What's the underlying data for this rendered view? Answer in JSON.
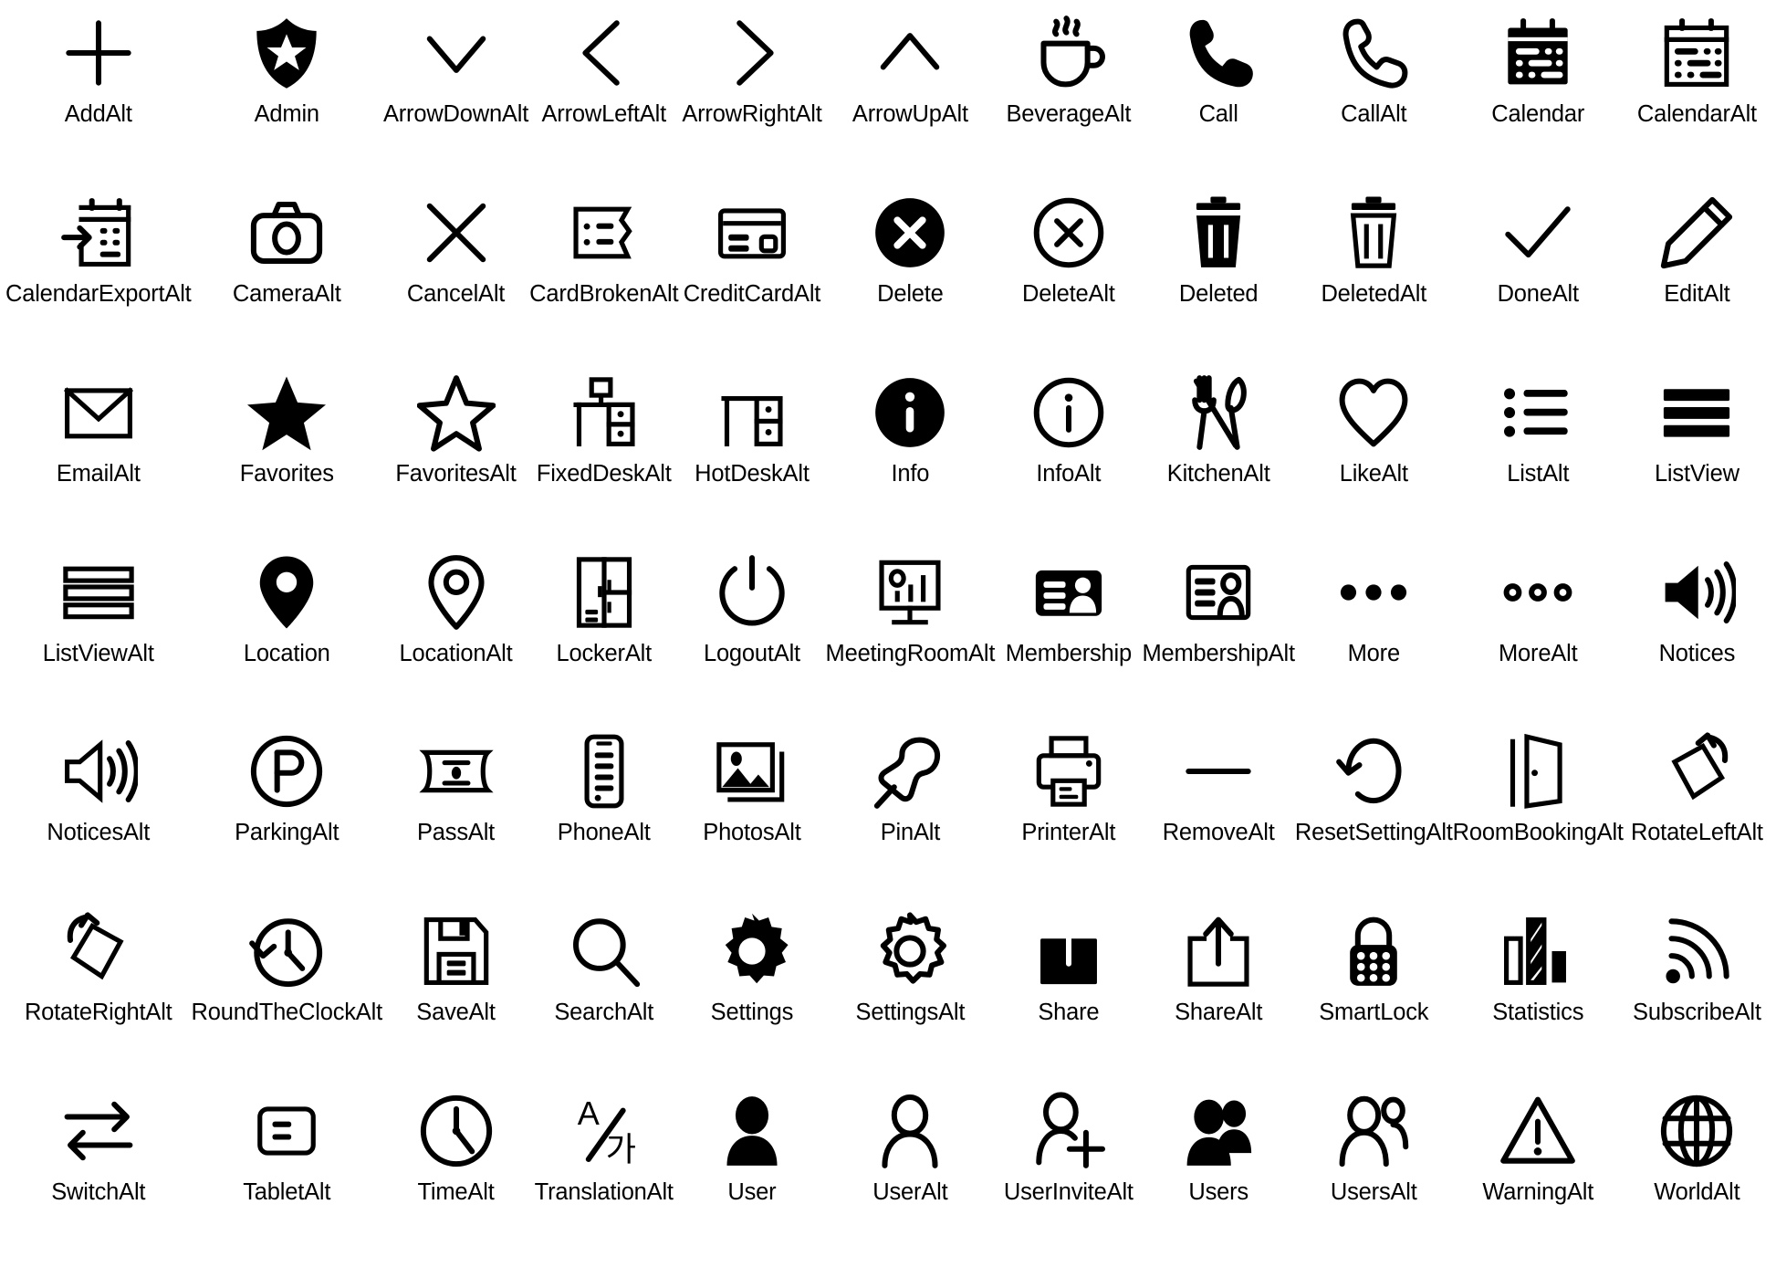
{
  "page": {
    "title": "Icon Set Sheet",
    "background_color": "#ffffff",
    "icon_color": "#000000",
    "columns": 11,
    "rows": 7,
    "total_icons": 77
  },
  "icons": [
    {
      "label": "AddAlt",
      "icon": "plus-icon"
    },
    {
      "label": "Admin",
      "icon": "shield-star-filled-icon"
    },
    {
      "label": "ArrowDownAlt",
      "icon": "chevron-down-icon"
    },
    {
      "label": "ArrowLeftAlt",
      "icon": "chevron-left-icon"
    },
    {
      "label": "ArrowRightAlt",
      "icon": "chevron-right-icon"
    },
    {
      "label": "ArrowUpAlt",
      "icon": "chevron-up-icon"
    },
    {
      "label": "BeverageAlt",
      "icon": "coffee-cup-icon"
    },
    {
      "label": "Call",
      "icon": "phone-handset-filled-icon"
    },
    {
      "label": "CallAlt",
      "icon": "phone-handset-outline-icon"
    },
    {
      "label": "Calendar",
      "icon": "calendar-filled-icon"
    },
    {
      "label": "CalendarAlt",
      "icon": "calendar-outline-icon"
    },
    {
      "label": "CalendarExportAlt",
      "icon": "calendar-export-icon"
    },
    {
      "label": "CameraAlt",
      "icon": "camera-icon"
    },
    {
      "label": "CancelAlt",
      "icon": "close-x-icon"
    },
    {
      "label": "CardBrokenAlt",
      "icon": "card-broken-icon"
    },
    {
      "label": "CreditCardAlt",
      "icon": "credit-card-icon"
    },
    {
      "label": "Delete",
      "icon": "close-circle-filled-icon"
    },
    {
      "label": "DeleteAlt",
      "icon": "close-circle-outline-icon"
    },
    {
      "label": "Deleted",
      "icon": "trash-filled-icon"
    },
    {
      "label": "DeletedAlt",
      "icon": "trash-outline-icon"
    },
    {
      "label": "DoneAlt",
      "icon": "check-icon"
    },
    {
      "label": "EditAlt",
      "icon": "pencil-icon"
    },
    {
      "label": "EmailAlt",
      "icon": "envelope-icon"
    },
    {
      "label": "Favorites",
      "icon": "star-filled-icon"
    },
    {
      "label": "FavoritesAlt",
      "icon": "star-outline-icon"
    },
    {
      "label": "FixedDeskAlt",
      "icon": "fixed-desk-icon"
    },
    {
      "label": "HotDeskAlt",
      "icon": "hot-desk-icon"
    },
    {
      "label": "Info",
      "icon": "info-circle-filled-icon"
    },
    {
      "label": "InfoAlt",
      "icon": "info-circle-outline-icon"
    },
    {
      "label": "KitchenAlt",
      "icon": "fork-spoon-icon"
    },
    {
      "label": "LikeAlt",
      "icon": "heart-outline-icon"
    },
    {
      "label": "ListAlt",
      "icon": "bullet-list-icon"
    },
    {
      "label": "ListView",
      "icon": "list-view-filled-icon"
    },
    {
      "label": "ListViewAlt",
      "icon": "list-view-outline-icon"
    },
    {
      "label": "Location",
      "icon": "map-pin-filled-icon"
    },
    {
      "label": "LocationAlt",
      "icon": "map-pin-outline-icon"
    },
    {
      "label": "LockerAlt",
      "icon": "locker-icon"
    },
    {
      "label": "LogoutAlt",
      "icon": "power-icon"
    },
    {
      "label": "MeetingRoomAlt",
      "icon": "meeting-room-icon"
    },
    {
      "label": "Membership",
      "icon": "membership-card-filled-icon"
    },
    {
      "label": "MembershipAlt",
      "icon": "membership-card-outline-icon"
    },
    {
      "label": "More",
      "icon": "more-dots-filled-icon"
    },
    {
      "label": "MoreAlt",
      "icon": "more-dots-outline-icon"
    },
    {
      "label": "Notices",
      "icon": "megaphone-filled-icon"
    },
    {
      "label": "NoticesAlt",
      "icon": "megaphone-outline-icon"
    },
    {
      "label": "ParkingAlt",
      "icon": "parking-circle-icon"
    },
    {
      "label": "PassAlt",
      "icon": "pass-ticket-icon"
    },
    {
      "label": "PhoneAlt",
      "icon": "mobile-phone-icon"
    },
    {
      "label": "PhotosAlt",
      "icon": "photos-stack-icon"
    },
    {
      "label": "PinAlt",
      "icon": "pushpin-icon"
    },
    {
      "label": "PrinterAlt",
      "icon": "printer-icon"
    },
    {
      "label": "RemoveAlt",
      "icon": "minus-icon"
    },
    {
      "label": "ResetSettingAlt",
      "icon": "reset-circular-arrow-icon"
    },
    {
      "label": "RoomBookingAlt",
      "icon": "open-door-icon"
    },
    {
      "label": "RotateLeftAlt",
      "icon": "rotate-left-icon"
    },
    {
      "label": "RotateRightAlt",
      "icon": "rotate-right-icon"
    },
    {
      "label": "RoundTheClockAlt",
      "icon": "clock-rewind-icon"
    },
    {
      "label": "SaveAlt",
      "icon": "floppy-disk-icon"
    },
    {
      "label": "SearchAlt",
      "icon": "magnifier-icon"
    },
    {
      "label": "Settings",
      "icon": "gear-filled-icon"
    },
    {
      "label": "SettingsAlt",
      "icon": "gear-outline-icon"
    },
    {
      "label": "Share",
      "icon": "share-upload-filled-icon"
    },
    {
      "label": "ShareAlt",
      "icon": "share-upload-outline-icon"
    },
    {
      "label": "SmartLock",
      "icon": "smart-lock-keypad-icon"
    },
    {
      "label": "Statistics",
      "icon": "bar-chart-icon"
    },
    {
      "label": "SubscribeAlt",
      "icon": "rss-waves-icon"
    },
    {
      "label": "SwitchAlt",
      "icon": "switch-arrows-icon"
    },
    {
      "label": "TabletAlt",
      "icon": "tablet-icon"
    },
    {
      "label": "TimeAlt",
      "icon": "clock-icon"
    },
    {
      "label": "TranslationAlt",
      "icon": "translation-icon"
    },
    {
      "label": "User",
      "icon": "user-filled-icon"
    },
    {
      "label": "UserAlt",
      "icon": "user-outline-icon"
    },
    {
      "label": "UserInviteAlt",
      "icon": "user-add-icon"
    },
    {
      "label": "Users",
      "icon": "users-filled-icon"
    },
    {
      "label": "UsersAlt",
      "icon": "users-outline-icon"
    },
    {
      "label": "WarningAlt",
      "icon": "warning-triangle-icon"
    },
    {
      "label": "WorldAlt",
      "icon": "globe-icon"
    }
  ]
}
